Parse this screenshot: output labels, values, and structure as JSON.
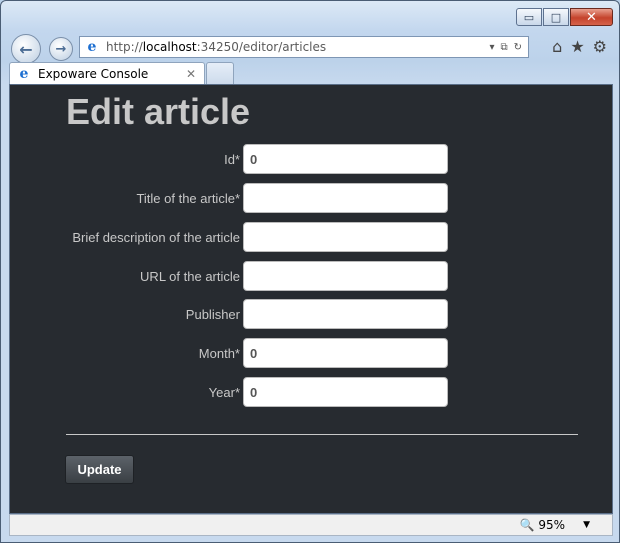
{
  "browser": {
    "caption_buttons": {
      "minimize": "▭",
      "maximize": "□",
      "close": "✕"
    },
    "nav": {
      "back_icon": "←",
      "forward_icon": "→"
    },
    "address": {
      "prefix": "http://",
      "host": "localhost",
      "rest": ":34250/editor/articles",
      "tools": [
        "▾",
        "⧉",
        "↻"
      ]
    },
    "right_icons": [
      "⌂",
      "★",
      "⚙"
    ],
    "tab": {
      "title": "Expoware Console",
      "close_icon": "✕"
    },
    "status": {
      "zoom": "95%",
      "dropdown": "▼"
    }
  },
  "page": {
    "title": "Edit article",
    "fields": [
      {
        "label": "Id*",
        "value": "0"
      },
      {
        "label": "Title of the article*",
        "value": ""
      },
      {
        "label": "Brief description of the article",
        "value": ""
      },
      {
        "label": "URL of the article",
        "value": ""
      },
      {
        "label": "Publisher",
        "value": ""
      },
      {
        "label": "Month*",
        "value": "0"
      },
      {
        "label": "Year*",
        "value": "0"
      }
    ],
    "update_label": "Update"
  }
}
